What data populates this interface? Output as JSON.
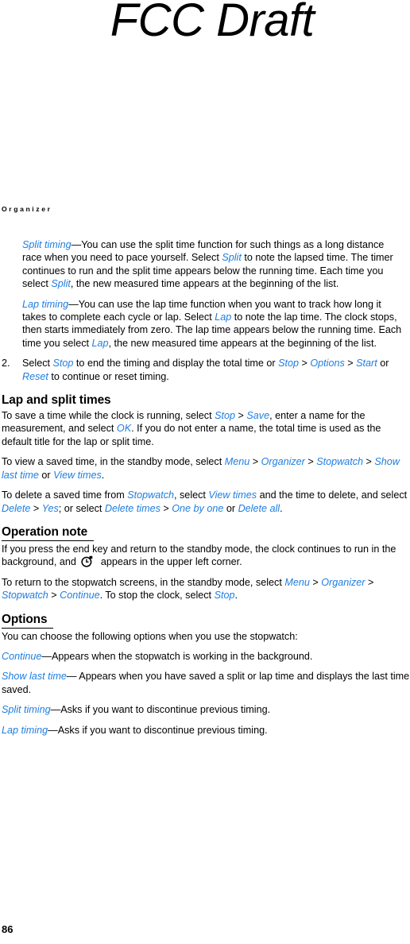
{
  "watermark": "FCC Draft",
  "running_head": "Organizer",
  "page_number": "86",
  "colors": {
    "ui_reference": "#1f7ee0",
    "text": "#000000",
    "background": "#ffffff"
  },
  "icons": {
    "stopwatch": "stopwatch-icon"
  },
  "body": {
    "split_timing": {
      "term": "Split timing",
      "p1": "—You can use the split time function for such things as a long distance race when you need to pace yourself. Select ",
      "ref1": "Split",
      "p2": " to note the lapsed time. The timer continues to run and the split time appears below the running time. Each time you select ",
      "ref2": "Split",
      "p3": ", the new measured time appears at the beginning of the list."
    },
    "lap_timing": {
      "term": "Lap timing",
      "p1": "—You can use the lap time function when you want to track how long it takes to complete each cycle or lap. Select ",
      "ref1": "Lap",
      "p2": " to note the lap time. The clock stops, then starts immediately from zero. The lap time appears below the running time. Each time you select ",
      "ref2": "Lap",
      "p3": ", the new measured time appears at the beginning of the list."
    },
    "step2": {
      "number": "2.",
      "p1": "Select ",
      "ref1": "Stop",
      "p2": " to end the timing and display the total time or ",
      "ref2": "Stop",
      "gt1": " > ",
      "ref3": "Options",
      "gt2": " > ",
      "ref4": "Start",
      "p3": " or ",
      "ref5": "Reset",
      "p4": " to continue or reset timing."
    }
  },
  "sections": {
    "lap_and_split": {
      "heading": "Lap and split times",
      "underline": false,
      "para1": {
        "p1": "To save a time while the clock is running, select ",
        "ref1": "Stop",
        "gt1": " > ",
        "ref2": "Save",
        "p2": ", enter a name for the measurement, and select ",
        "ref3": "OK",
        "p3": ". If you do not enter a name, the total time is used as the default title for the lap or split time."
      },
      "para2": {
        "p1": "To view a saved time, in the standby mode, select ",
        "ref1": "Menu",
        "gt1": " > ",
        "ref2": "Organizer",
        "gt2": " > ",
        "ref3": "Stopwatch",
        "gt3": " > ",
        "ref4": "Show last time",
        "p2": " or ",
        "ref5": "View times",
        "p3": "."
      },
      "para3": {
        "p1": "To delete a saved time from ",
        "ref1": "Stopwatch",
        "p2": ", select ",
        "ref2": "View times",
        "p3": " and the time to delete, and select ",
        "ref3": "Delete",
        "gt1": " > ",
        "ref4": "Yes",
        "p4": "; or select ",
        "ref5": "Delete times",
        "gt2": " > ",
        "ref6": "One by one",
        "p5": " or ",
        "ref7": "Delete all",
        "p6": "."
      }
    },
    "operation_note": {
      "heading": "Operation note",
      "underline": true,
      "para1": {
        "p1": "If you press the end key and return to the standby mode, the clock continues to run in the background, and ",
        "p2": " appears in the upper left corner."
      },
      "para2": {
        "p1": "To return to the stopwatch screens, in the standby mode, select ",
        "ref1": "Menu",
        "gt1": " > ",
        "ref2": "Organizer",
        "gt2": " > ",
        "ref3": "Stopwatch",
        "gt3": " > ",
        "ref4": "Continue",
        "p2": ". To stop the clock, select ",
        "ref5": "Stop",
        "p3": "."
      }
    },
    "options": {
      "heading": "Options",
      "underline": true,
      "intro": "You can choose the following options when you use the stopwatch:",
      "items": [
        {
          "term": "Continue",
          "desc": "—Appears when the stopwatch is working in the background."
        },
        {
          "term": "Show last time",
          "desc": "— Appears when you have saved a split or lap time and displays the last time saved."
        },
        {
          "term": "Split timing",
          "desc": "—Asks if you want to discontinue previous timing."
        },
        {
          "term": "Lap timing",
          "desc": "—Asks if you want to discontinue previous timing."
        }
      ]
    }
  }
}
